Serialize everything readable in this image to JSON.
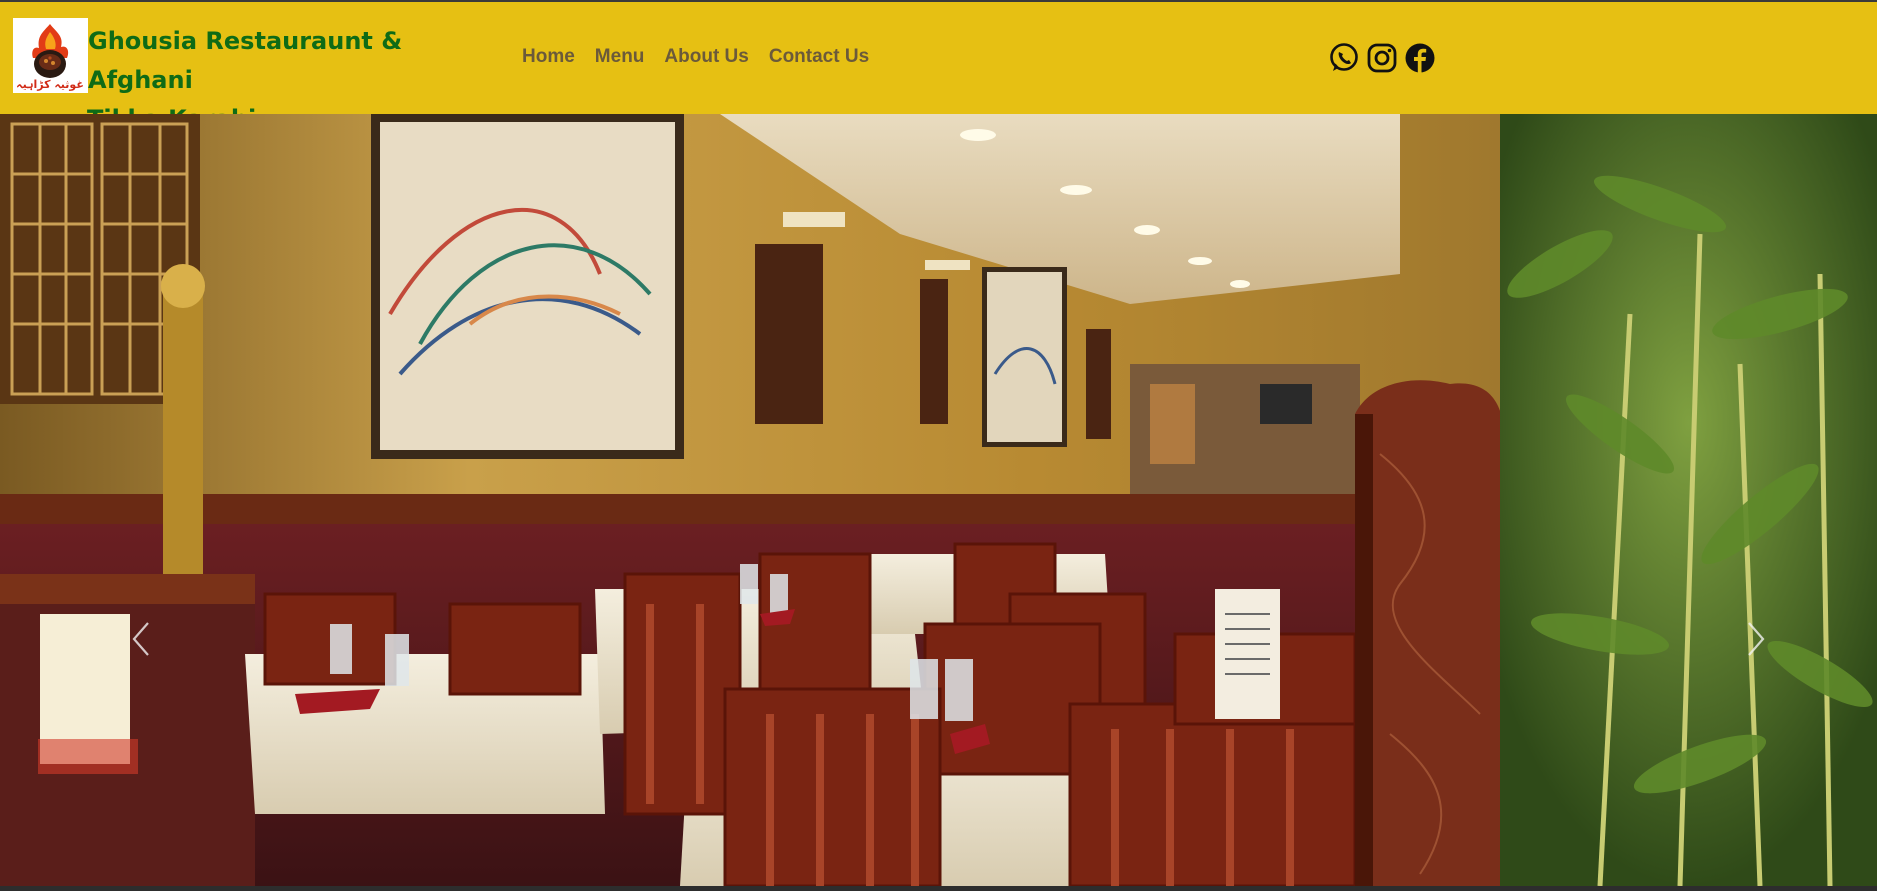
{
  "site": {
    "title_line1": "Ghousia Restauraunt & Afghani",
    "title_line2": "Tikka Karahi",
    "logo_caption": "غوثیہ کڑاہیہ"
  },
  "nav": {
    "items": [
      "Home",
      "Menu",
      "About Us",
      "Contact Us"
    ]
  },
  "social": {
    "icons": [
      "whatsapp-icon",
      "instagram-icon",
      "facebook-icon"
    ]
  },
  "carousel": {
    "prev_icon": "chevron-left-icon",
    "next_icon": "chevron-right-icon",
    "slide_image": "restaurant-dining-room-photo"
  },
  "colors": {
    "navbar_bg": "#e6c013",
    "brand_text": "#0f6b16",
    "nav_text": "#6b5a3a"
  }
}
